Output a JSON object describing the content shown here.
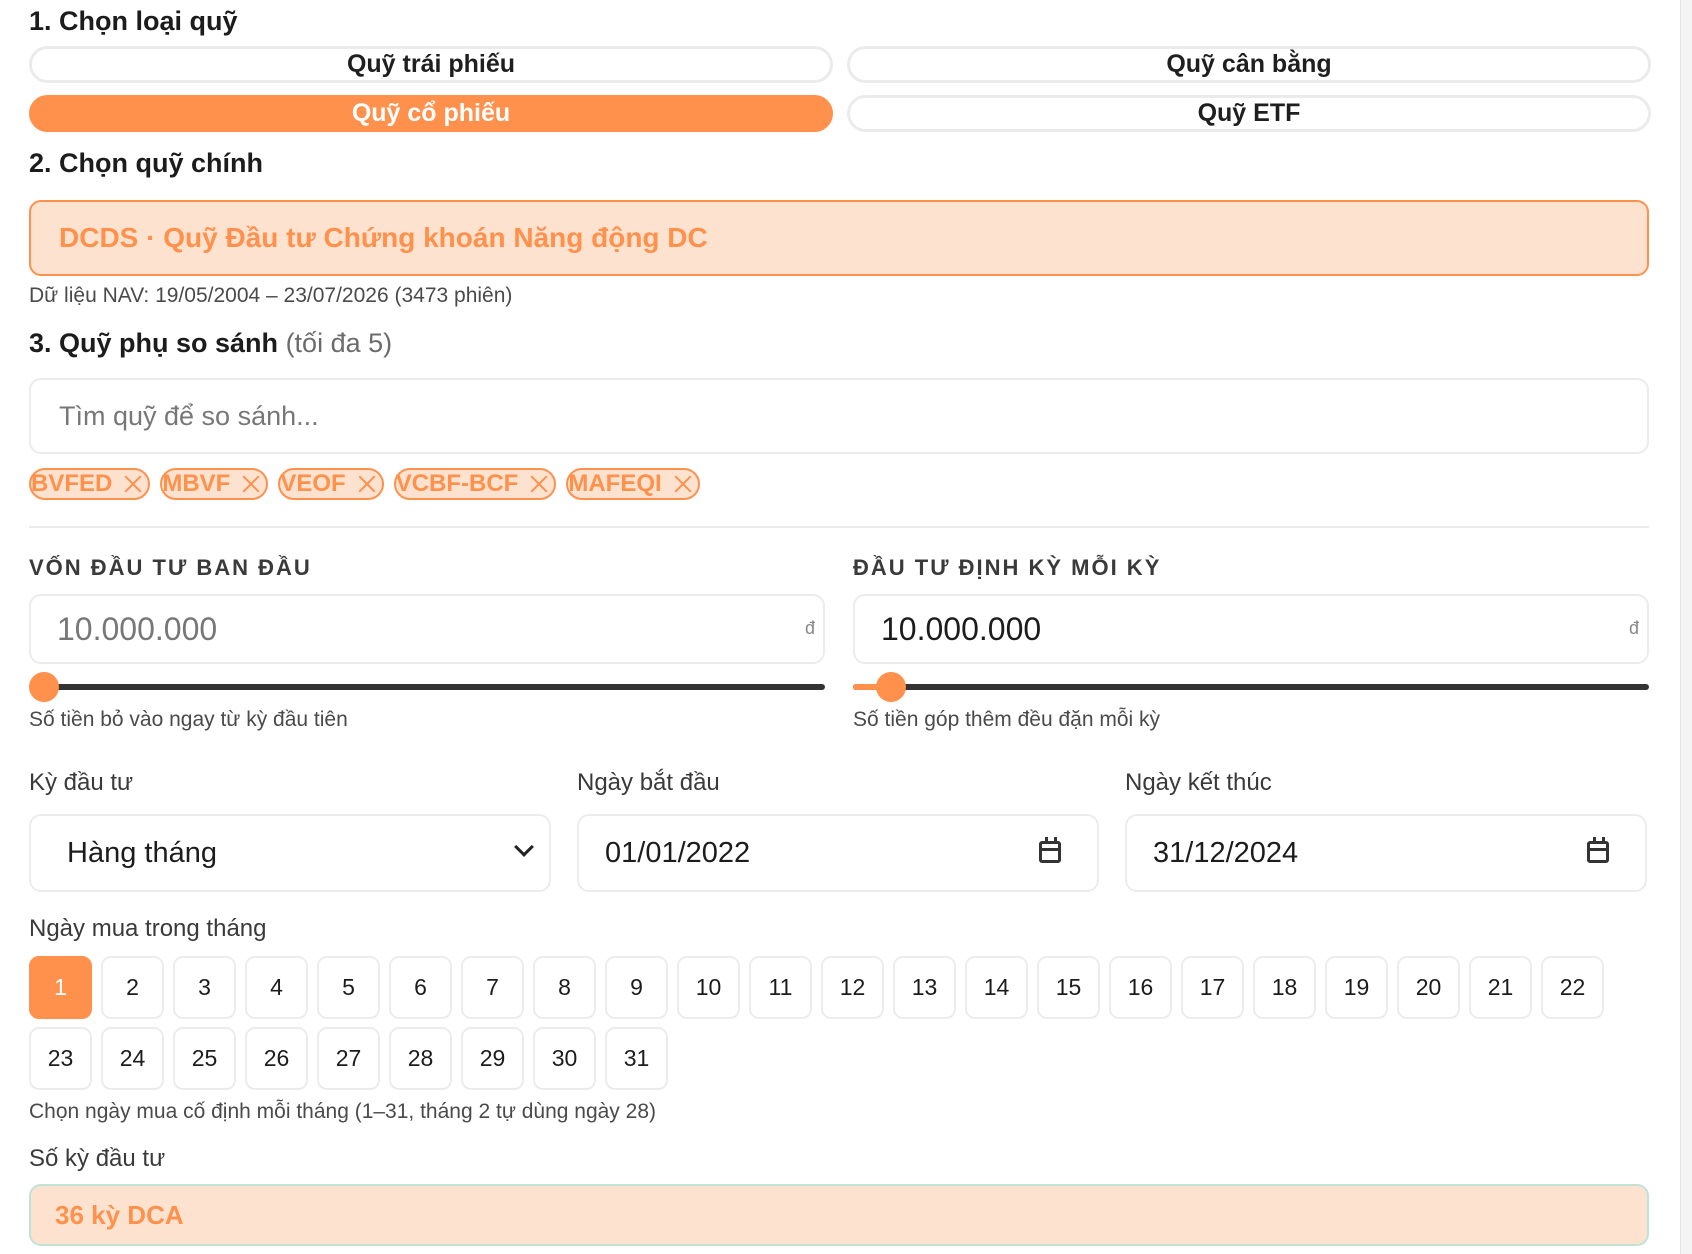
{
  "section1": {
    "title": "1. Chọn loại quỹ"
  },
  "fund_types": [
    {
      "label": "Quỹ trái phiếu",
      "active": false
    },
    {
      "label": "Quỹ cân bằng",
      "active": false
    },
    {
      "label": "Quỹ cổ phiếu",
      "active": true
    },
    {
      "label": "Quỹ ETF",
      "active": false
    }
  ],
  "section2": {
    "title": "2. Chọn quỹ chính",
    "selected_fund": "DCDS · Quỹ Đầu tư Chứng khoán Năng động DC",
    "nav_info": "Dữ liệu NAV: 19/05/2004 – 23/07/2026 (3473 phiên)"
  },
  "section3": {
    "title": "3. Quỹ phụ so sánh",
    "title_note": "(tối đa 5)",
    "search_placeholder": "Tìm quỹ để so sánh...",
    "chips": [
      "BVFED",
      "MBVF",
      "VEOF",
      "VCBF-BCF",
      "MAFEQI"
    ]
  },
  "initial_capital": {
    "label": "VỐN ĐẦU TƯ BAN ĐẦU",
    "placeholder": "10.000.000",
    "unit": "đ",
    "slider_fraction": 0.0,
    "hint": "Số tiền bỏ vào ngay từ kỳ đầu tiên"
  },
  "periodic_investment": {
    "label": "ĐẦU TƯ ĐỊNH KỲ MỖI KỲ",
    "value": "10.000.000",
    "unit": "đ",
    "slider_fraction": 0.03,
    "hint": "Số tiền góp thêm đều đặn mỗi kỳ"
  },
  "period": {
    "label": "Kỳ đầu tư",
    "value": "Hàng tháng"
  },
  "start_date": {
    "label": "Ngày bắt đầu",
    "value": "01/01/2022"
  },
  "end_date": {
    "label": "Ngày kết thúc",
    "value": "31/12/2024"
  },
  "buy_day": {
    "label": "Ngày mua trong tháng",
    "days": [
      "1",
      "2",
      "3",
      "4",
      "5",
      "6",
      "7",
      "8",
      "9",
      "10",
      "11",
      "12",
      "13",
      "14",
      "15",
      "16",
      "17",
      "18",
      "19",
      "20",
      "21",
      "22",
      "23",
      "24",
      "25",
      "26",
      "27",
      "28",
      "29",
      "30",
      "31"
    ],
    "selected": "1",
    "hint": "Chọn ngày mua cố định mỗi tháng (1–31, tháng 2 tự dùng ngày 28)"
  },
  "periods_count": {
    "label": "Số kỳ đầu tư",
    "value": "36 kỳ DCA"
  },
  "colors": {
    "accent": "#ff914d",
    "accent_soft": "#fde3cf",
    "border": "#ececec"
  }
}
